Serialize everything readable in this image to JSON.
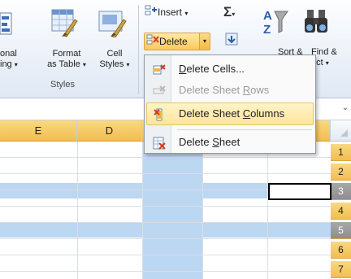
{
  "ribbon": {
    "cond_fmt_label_line1": "onal",
    "cond_fmt_label_line2": "ing",
    "format_table_label_line1": "Format",
    "format_table_label_line2": "as Table",
    "cell_styles_label_line1": "Cell",
    "cell_styles_label_line2": "Styles",
    "styles_group_label": "Styles",
    "insert_label": "Insert",
    "delete_label": "Delete",
    "sort_label_partial": "Sort &",
    "find_label_partial": "Find &",
    "find_label_line2_partial": "ect",
    "sigma_glyph": "Σ",
    "dropdown_glyph": "▾",
    "cells_group_label": ""
  },
  "context_menu": {
    "items": [
      {
        "pre": "",
        "key": "D",
        "post": "elete Cells...",
        "enabled": true
      },
      {
        "pre": "Delete Sheet ",
        "key": "R",
        "post": "ows",
        "enabled": false
      },
      {
        "pre": "Delete Sheet ",
        "key": "C",
        "post": "olumns",
        "enabled": true,
        "highlighted": true
      },
      {
        "pre": "Delete ",
        "key": "S",
        "post": "heet",
        "enabled": true
      }
    ]
  },
  "grid": {
    "column_headers": [
      "E",
      "D",
      "",
      "",
      ""
    ],
    "row_headers": [
      "1",
      "2",
      "3",
      "4",
      "5",
      "6",
      "7"
    ],
    "selected_rows": [
      "3",
      "5"
    ],
    "highlighted_column": "C"
  },
  "colors": {
    "selection_blue": "#bcd7f1",
    "header_highlight": "#f2bd50",
    "menu_hover": "#fde59b"
  }
}
